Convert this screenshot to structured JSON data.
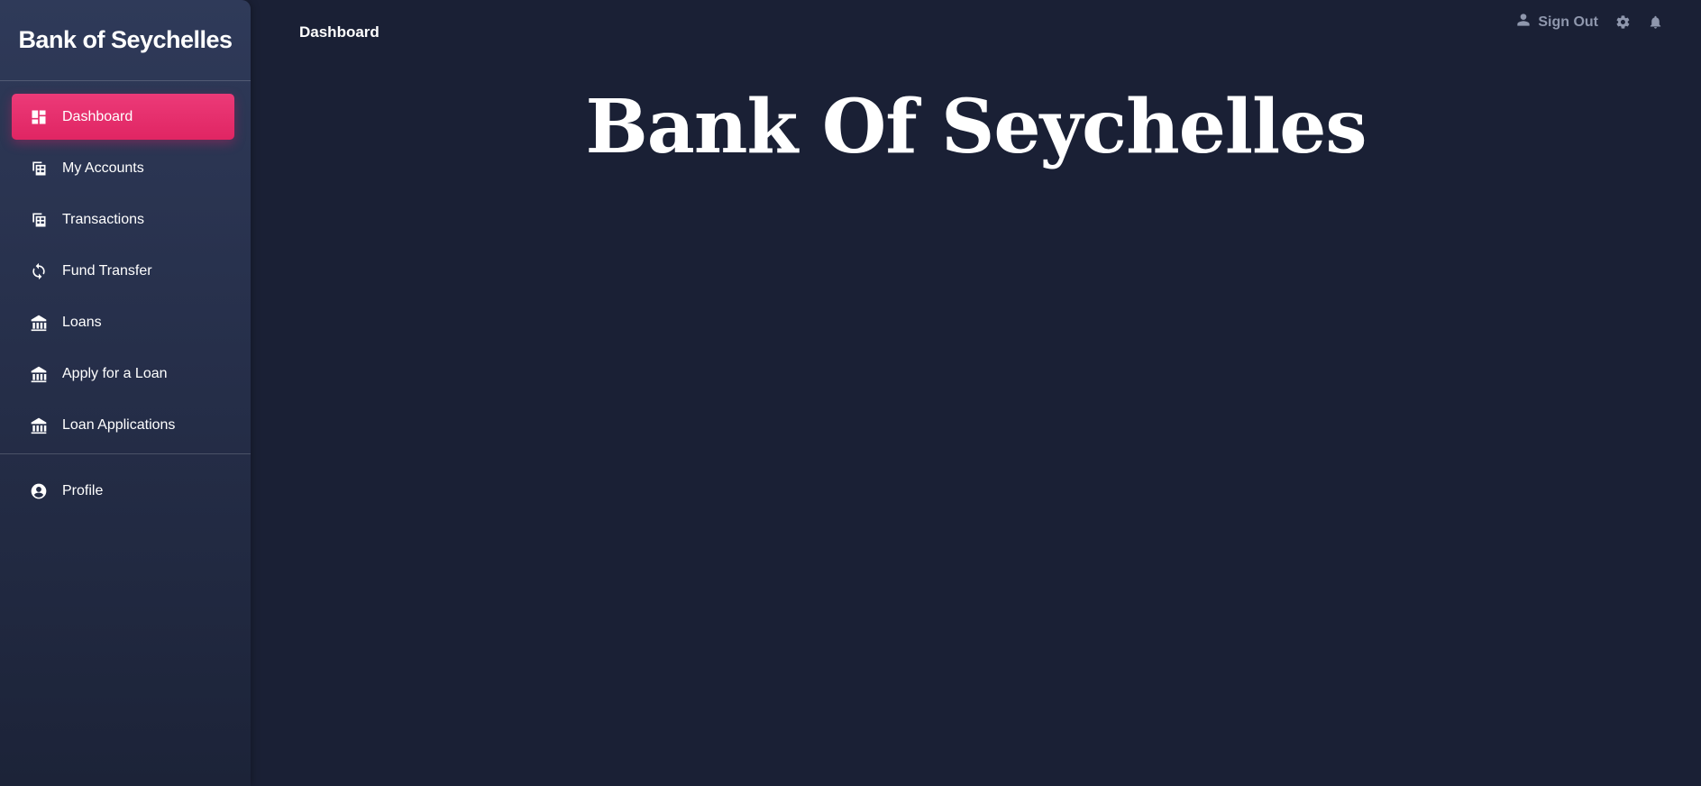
{
  "sidebar": {
    "brand": "Bank of Seychelles",
    "items": [
      {
        "label": "Dashboard",
        "icon": "dashboard-icon",
        "active": true
      },
      {
        "label": "My Accounts",
        "icon": "account-balance-icon"
      },
      {
        "label": "Transactions",
        "icon": "account-balance-icon"
      },
      {
        "label": "Fund Transfer",
        "icon": "transfer-icon"
      },
      {
        "label": "Loans",
        "icon": "loan-icon"
      },
      {
        "label": "Apply for a Loan",
        "icon": "loan-icon"
      },
      {
        "label": "Loan Applications",
        "icon": "loan-icon"
      }
    ],
    "profile": {
      "label": "Profile",
      "icon": "account-circle-icon"
    }
  },
  "header": {
    "title": "Dashboard",
    "sign_out": "Sign Out",
    "icons": [
      "user-icon",
      "gear-icon",
      "bell-icon"
    ]
  },
  "main": {
    "heading": "Bank Of Seychelles"
  },
  "colors": {
    "background": "#1a2035",
    "accent": "#e91e63",
    "muted": "#8f97ad"
  }
}
